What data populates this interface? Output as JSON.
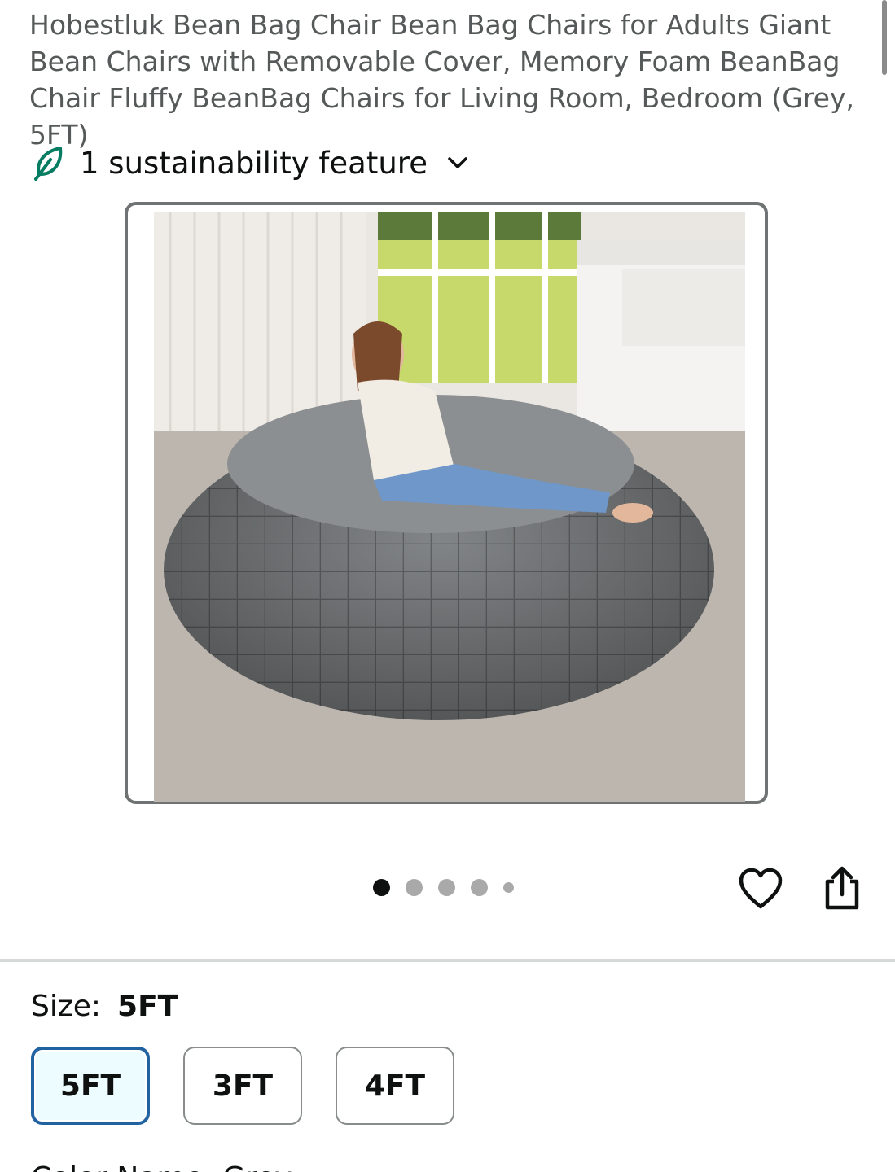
{
  "product": {
    "title": "Hobestluk Bean Bag Chair Bean Bag Chairs for Adults Giant Bean Chairs with Removable Cover, Memory Foam BeanBag Chair Fluffy BeanBag Chairs for Living Room, Bedroom (Grey, 5FT)"
  },
  "sustainability": {
    "label": "1 sustainability feature",
    "icon": "leaf-icon",
    "toggle_icon": "chevron-down-icon"
  },
  "gallery": {
    "image_alt": "Grey bean bag chair with woman",
    "dot_count": 5,
    "active_index": 0
  },
  "actions": {
    "favorite_icon": "heart-icon",
    "share_icon": "share-icon"
  },
  "size": {
    "label": "Size:",
    "selected": "5FT",
    "options": [
      {
        "label": "5FT",
        "selected": true
      },
      {
        "label": "3FT",
        "selected": false
      },
      {
        "label": "4FT",
        "selected": false
      }
    ]
  },
  "next_section": {
    "partial_label": "Color Name: Grey"
  },
  "colors": {
    "accent": "#2162a1",
    "leaf": "#067d62"
  }
}
